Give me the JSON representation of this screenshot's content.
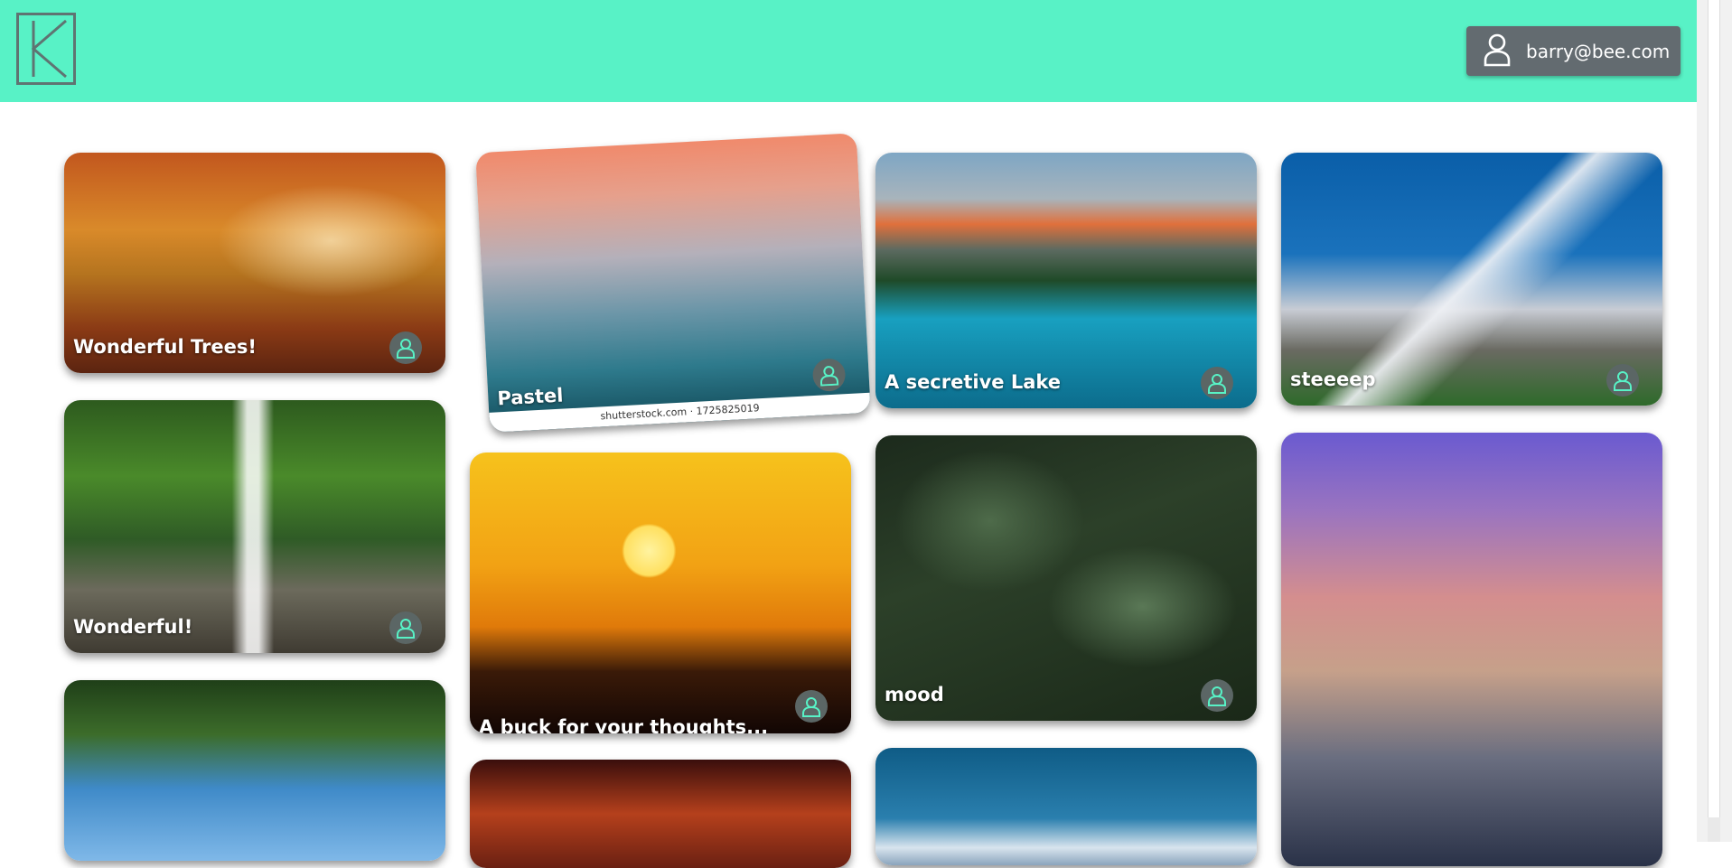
{
  "header": {
    "user_email": "barry@bee.com"
  },
  "cards": [
    {
      "title": "Wonderful Trees!"
    },
    {
      "title": "Wonderful!"
    },
    {
      "title": "Pastel",
      "watermark": "shutterstock.com · 1725825019"
    },
    {
      "title": "A buck for your thoughts..."
    },
    {
      "title": "A secretive Lake"
    },
    {
      "title": "mood"
    },
    {
      "title": "steeeep"
    }
  ]
}
